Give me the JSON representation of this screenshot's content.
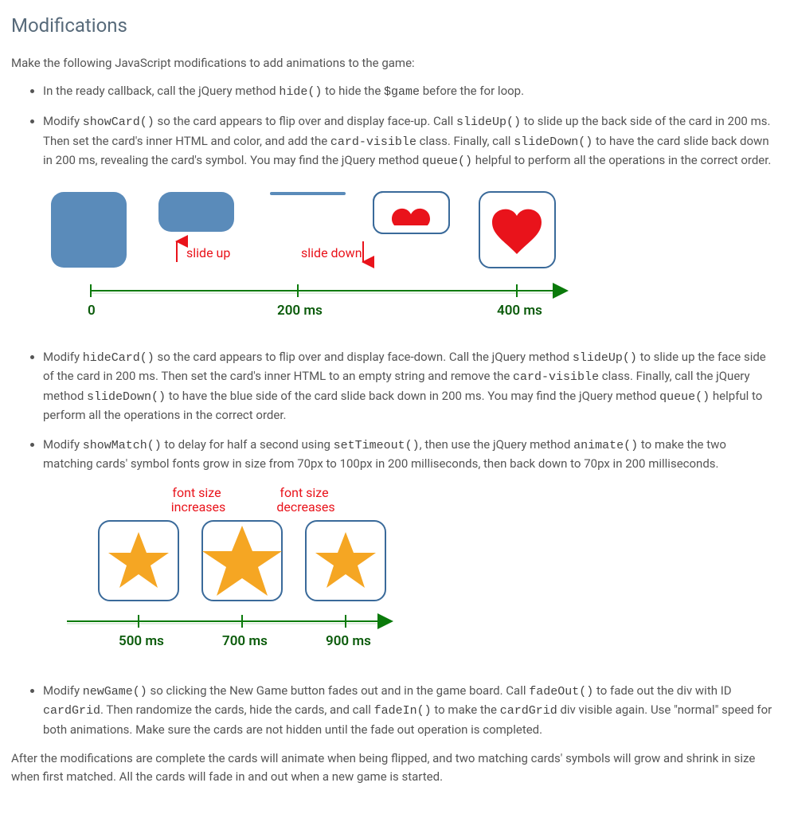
{
  "heading": "Modifications",
  "intro": "Make the following JavaScript modifications to add animations to the game:",
  "bullets": {
    "b1": {
      "p1a": "In the ready callback, call the jQuery method ",
      "c1": "hide()",
      "p1b": " to hide the ",
      "c2": "$game",
      "p1c": " before the for loop."
    },
    "b2": {
      "p1a": "Modify ",
      "c1": "showCard()",
      "p1b": " so the card appears to flip over and display face-up. Call ",
      "c2": "slideUp()",
      "p1c": " to slide up the back side of the card in 200 ms. Then set the card's inner HTML and color, and add the ",
      "c3": "card-visible",
      "p1d": " class. Finally, call ",
      "c4": "slideDown()",
      "p1e": " to have the card slide back down in 200 ms, revealing the card's symbol. You may find the jQuery method ",
      "c5": "queue()",
      "p1f": " helpful to perform all the operations in the correct order."
    },
    "b3": {
      "p1a": "Modify ",
      "c1": "hideCard()",
      "p1b": " so the card appears to flip over and display face-down. Call the jQuery method ",
      "c2": "slideUp()",
      "p1c": " to slide up the face side of the card in 200 ms. Then set the card's inner HTML to an empty string and remove the ",
      "c3": "card-visible",
      "p1d": " class. Finally, call the jQuery method ",
      "c4": "slideDown()",
      "p1e": " to have the blue side of the card slide back down in 200 ms. You may find the jQuery method ",
      "c5": "queue()",
      "p1f": " helpful to perform all the operations in the correct order."
    },
    "b4": {
      "p1a": "Modify ",
      "c1": "showMatch()",
      "p1b": " to delay for half a second using ",
      "c2": "setTimeout()",
      "p1c": ", then use the jQuery method ",
      "c3": "animate()",
      "p1d": " to make the two matching cards' symbol fonts grow in size from 70px to 100px in 200 milliseconds, then back down to 70px in 200 milliseconds."
    },
    "b5": {
      "p1a": "Modify ",
      "c1": "newGame()",
      "p1b": " so clicking the New Game button fades out and in the game board. Call ",
      "c2": "fadeOut()",
      "p1c": " to fade out the div with ID ",
      "c3": "cardGrid",
      "p1d": ". Then randomize the cards, hide the cards, and call ",
      "c4": "fadeIn()",
      "p1e": " to make the ",
      "c5": "cardGrid",
      "p1f": " div visible again. Use \"normal\" speed for both animations. Make sure the cards are not hidden until the fade out operation is completed."
    }
  },
  "outro": "After the modifications are complete the cards will animate when being flipped, and two matching cards' symbols will grow and shrink in size when first matched. All the cards will fade in and out when a new game is started.",
  "diagram1": {
    "slide_up": "slide up",
    "slide_down": "slide down",
    "tick0": "0",
    "tick200": "200 ms",
    "tick400": "400 ms"
  },
  "diagram2": {
    "inc": "font size\nincreases",
    "dec": "font size\ndecreases",
    "tick500": "500 ms",
    "tick700": "700 ms",
    "tick900": "900 ms"
  },
  "colors": {
    "card_blue": "#5a8bba",
    "card_border": "#3a6a9a",
    "heart_red": "#e9131b",
    "star_orange": "#f5a623",
    "axis_green": "#0a7a0a",
    "label_red": "#e9131b",
    "tick_text": "#0b5b0b"
  }
}
